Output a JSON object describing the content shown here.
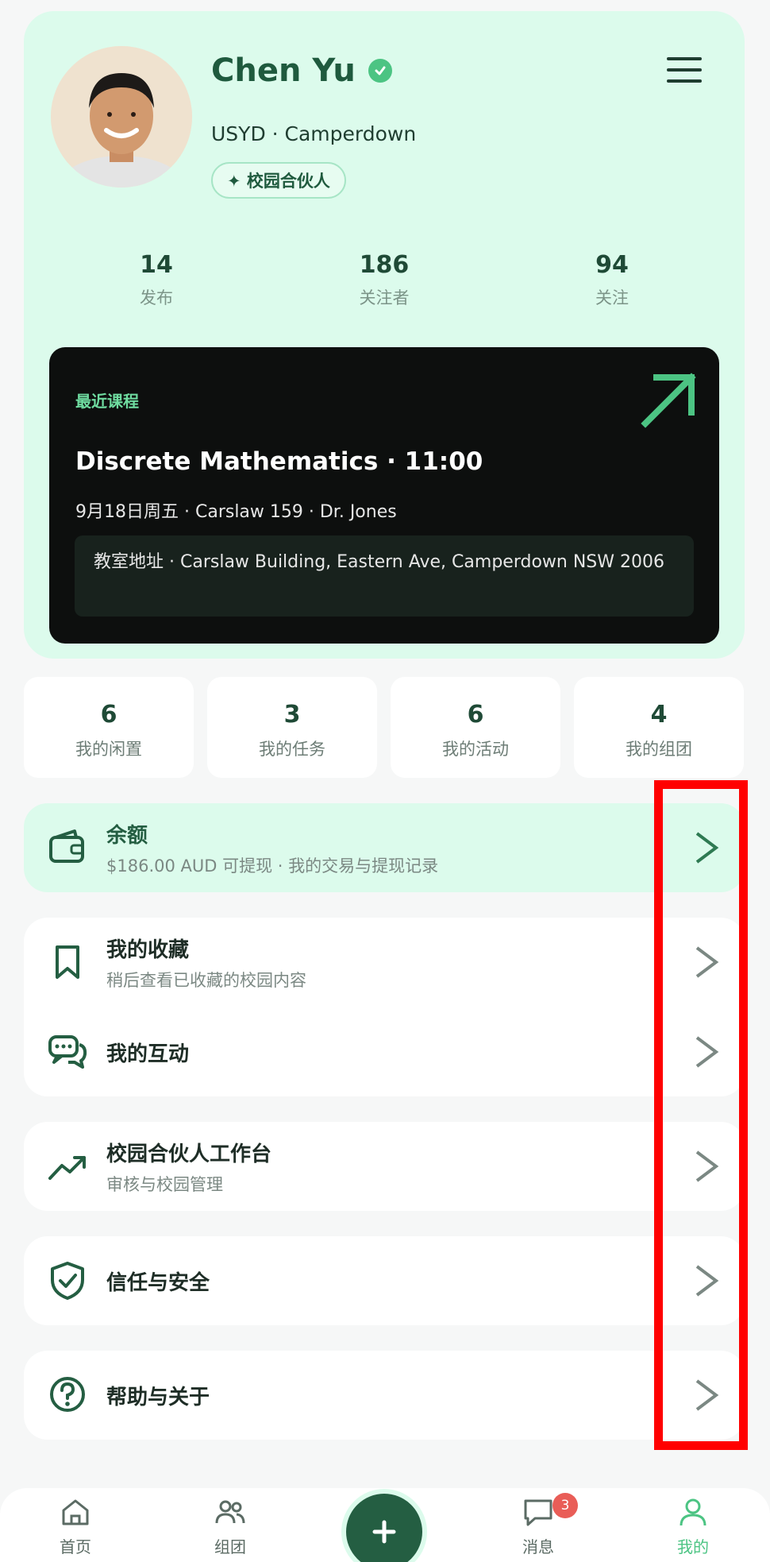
{
  "profile": {
    "name": "Chen Yu",
    "school": "USYD · Camperdown",
    "tag": "✦ 校园合伙人"
  },
  "stats": [
    {
      "value": "14",
      "label": "发布"
    },
    {
      "value": "186",
      "label": "关注者"
    },
    {
      "value": "94",
      "label": "关注"
    }
  ],
  "course": {
    "eyebrow": "最近课程",
    "title": "Discrete Mathematics · 11:00",
    "meta": "9月18日周五 · Carslaw 159 · Dr. Jones",
    "address": "教室地址 · Carslaw Building, Eastern Ave, Camperdown NSW 2006"
  },
  "quick_stats": [
    {
      "value": "6",
      "label": "我的闲置"
    },
    {
      "value": "3",
      "label": "我的任务"
    },
    {
      "value": "6",
      "label": "我的活动"
    },
    {
      "value": "4",
      "label": "我的组团"
    }
  ],
  "balance": {
    "title": "余额",
    "subtitle": "$186.00 AUD 可提现 · 我的交易与提现记录"
  },
  "menu": {
    "favorites": {
      "title": "我的收藏",
      "subtitle": "稍后查看已收藏的校园内容"
    },
    "interactions": {
      "title": "我的互动"
    },
    "partner": {
      "title": "校园合伙人工作台",
      "subtitle": "审核与校园管理"
    },
    "trust": {
      "title": "信任与安全"
    },
    "help": {
      "title": "帮助与关于"
    }
  },
  "nav": {
    "home": "首页",
    "groups": "组团",
    "messages": "消息",
    "messages_badge": "3",
    "me": "我的"
  },
  "colors": {
    "accent": "#4cc483",
    "dark_green": "#245e42",
    "mint": "#dcfbec",
    "highlight": "#ff0000"
  }
}
